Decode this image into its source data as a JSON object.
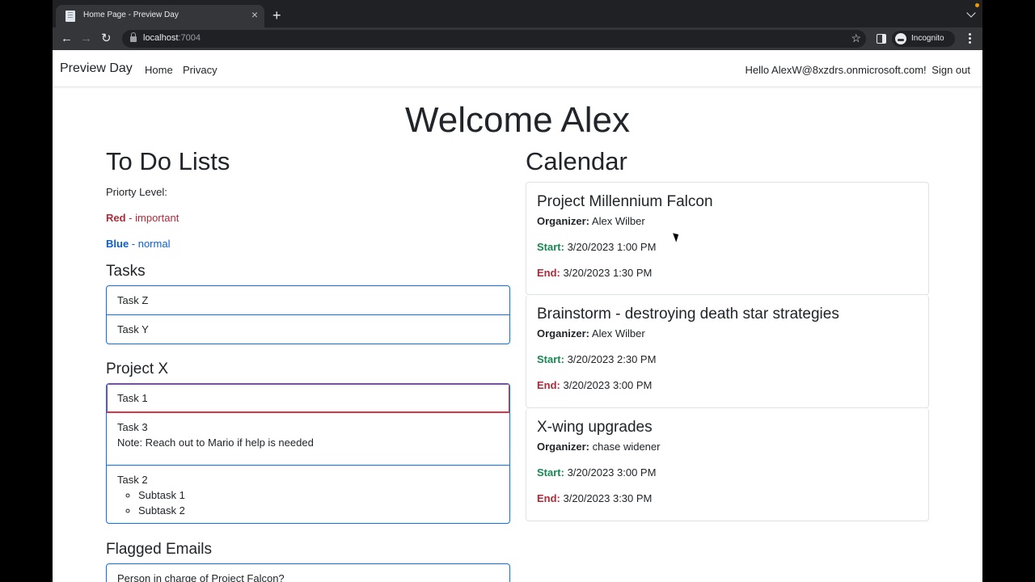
{
  "browser": {
    "tab_title": "Home Page - Preview Day",
    "url_host": "localhost",
    "url_port": ":7004",
    "incognito_label": "Incognito"
  },
  "nav": {
    "brand": "Preview Day",
    "links": [
      "Home",
      "Privacy"
    ],
    "greeting": "Hello AlexW@8xzdrs.onmicrosoft.com!",
    "sign_out": "Sign out"
  },
  "welcome": "Welcome Alex",
  "todo": {
    "heading": "To Do Lists",
    "priority_label": "Priorty Level:",
    "red_label": "Red",
    "red_desc": " - important",
    "blue_label": "Blue",
    "blue_desc": " - normal",
    "tasks_heading": "Tasks",
    "tasks": [
      "Task Z",
      "Task Y"
    ],
    "project_heading": "Project X",
    "project_task1": "Task 1",
    "project_task3": "Task 3",
    "project_task3_note": "Note: Reach out to Mario if help is needed",
    "project_task2": "Task 2",
    "subtasks": [
      "Subtask 1",
      "Subtask 2"
    ],
    "flagged_heading": "Flagged Emails",
    "flagged": [
      "Person in charge of Project Falcon?"
    ]
  },
  "calendar": {
    "heading": "Calendar",
    "organizer_label": "Organizer:",
    "start_label": "Start:",
    "end_label": "End:",
    "events": [
      {
        "title": "Project Millennium Falcon",
        "organizer": "Alex Wilber",
        "start": "3/20/2023 1:00 PM",
        "end": "3/20/2023 1:30 PM"
      },
      {
        "title": "Brainstorm - destroying death star strategies",
        "organizer": "Alex Wilber",
        "start": "3/20/2023 2:30 PM",
        "end": "3/20/2023 3:00 PM"
      },
      {
        "title": "X-wing upgrades",
        "organizer": "chase widener",
        "start": "3/20/2023 3:00 PM",
        "end": "3/20/2023 3:30 PM"
      }
    ]
  },
  "colors": {
    "important": "#b02a37",
    "normal": "#0b5ed7",
    "start": "#198754"
  }
}
